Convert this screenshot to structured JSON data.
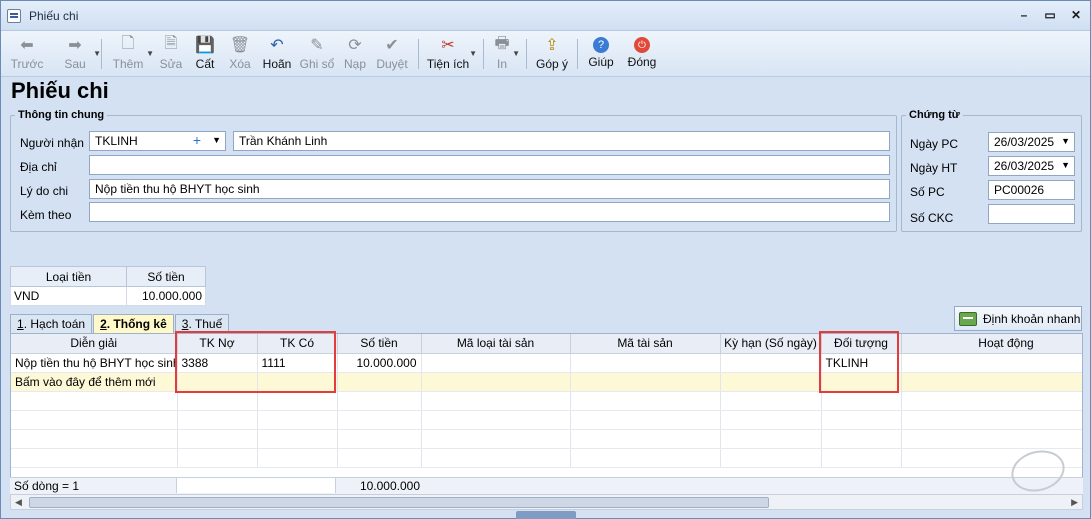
{
  "window": {
    "title": "Phiếu chi"
  },
  "toolbar": {
    "buttons": [
      {
        "label": "Trước",
        "icon": "arrow-left-icon"
      },
      {
        "label": "Sau",
        "icon": "arrow-right-icon"
      },
      {
        "label": "Thêm",
        "icon": "new-document-icon"
      },
      {
        "label": "Sửa",
        "icon": "edit-document-icon"
      },
      {
        "label": "Cất",
        "icon": "save-icon"
      },
      {
        "label": "Xóa",
        "icon": "delete-document-icon"
      },
      {
        "label": "Hoãn",
        "icon": "undo-icon"
      },
      {
        "label": "Ghi sổ",
        "icon": "pencil-icon"
      },
      {
        "label": "Nạp",
        "icon": "refresh-icon"
      },
      {
        "label": "Duyệt",
        "icon": "checkmark-icon"
      },
      {
        "label": "Tiện ích",
        "icon": "tools-icon"
      },
      {
        "label": "In",
        "icon": "printer-icon"
      },
      {
        "label": "Góp ý",
        "icon": "feedback-icon"
      },
      {
        "label": "Giúp",
        "icon": "help-icon"
      },
      {
        "label": "Đóng",
        "icon": "power-icon"
      }
    ]
  },
  "page": {
    "heading": "Phiếu chi"
  },
  "general_info": {
    "legend": "Thông tin chung",
    "recipient_label": "Người nhận",
    "recipient_code": "TKLINH",
    "recipient_name": "Trần Khánh Linh",
    "address_label": "Địa chỉ",
    "address_value": "",
    "reason_label": "Lý do chi",
    "reason_value": "Nộp tiền thu hộ BHYT học sinh",
    "attach_label": "Kèm theo",
    "attach_value": ""
  },
  "voucher": {
    "legend": "Chứng từ",
    "pc_date_label": "Ngày PC",
    "pc_date": "26/03/2025",
    "ht_date_label": "Ngày HT",
    "ht_date": "26/03/2025",
    "pc_no_label": "Số PC",
    "pc_no": "PC00026",
    "ckc_label": "Số CKC",
    "ckc_value": ""
  },
  "currency_table": {
    "headers": [
      "Loại tiền",
      "Số tiền"
    ],
    "row": [
      "VND",
      "10.000.000"
    ]
  },
  "tabs": [
    {
      "key": "1",
      "label": ". Hạch toán"
    },
    {
      "key": "2",
      "label": ". Thống kê"
    },
    {
      "key": "3",
      "label": ". Thuế"
    }
  ],
  "quick_entry_button": "Định khoản nhanh",
  "grid": {
    "headers": [
      "Diễn giải",
      "TK Nợ",
      "TK Có",
      "Số tiền",
      "Mã loại tài sản",
      "Mã tài sản",
      "Kỳ hạn (Số ngày)",
      "Đối tượng",
      "Hoạt động"
    ],
    "rows": [
      [
        "Nộp tiền thu hộ BHYT học sinh",
        "3388",
        "1111",
        "10.000.000",
        "",
        "",
        "",
        "TKLINH",
        ""
      ]
    ],
    "new_row_hint": "Bấm vào đây để thêm mới",
    "footer_count": "Số dòng = 1",
    "footer_total": "10.000.000"
  }
}
